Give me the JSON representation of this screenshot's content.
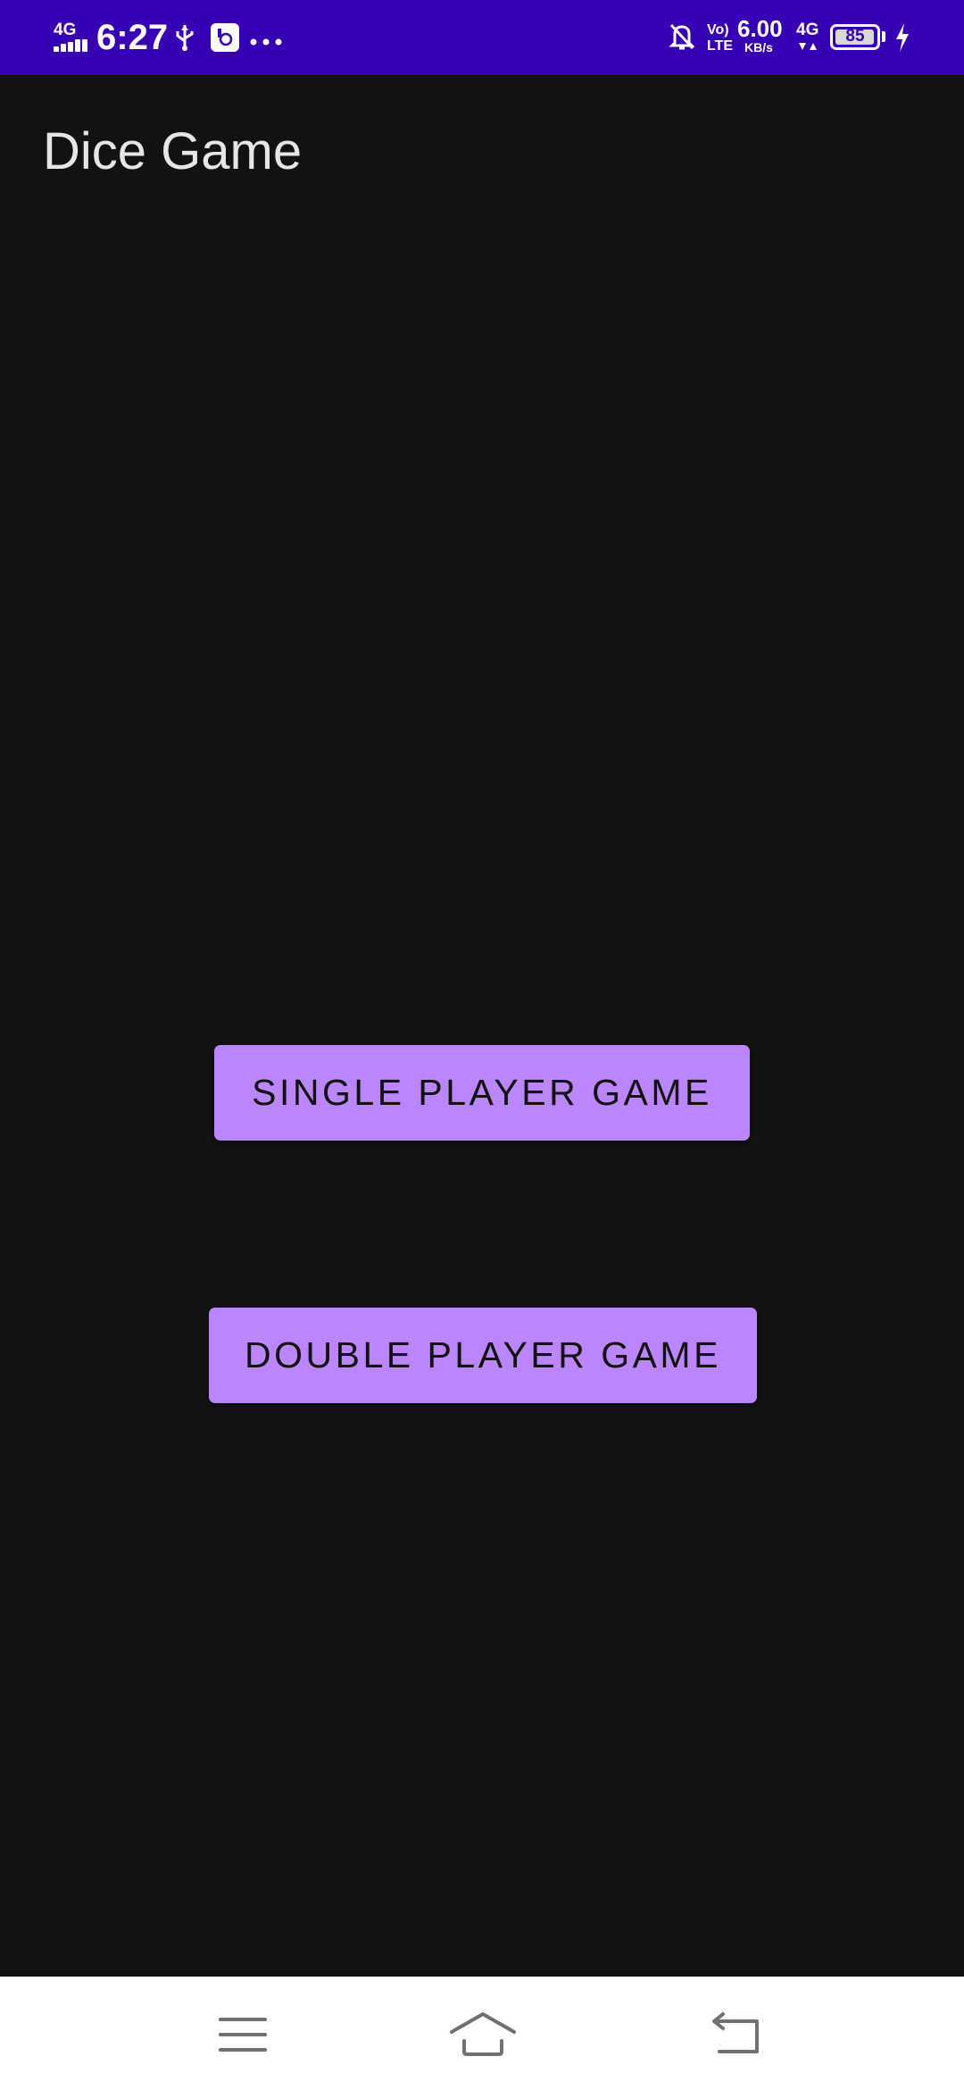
{
  "status_bar": {
    "network_type": "4G",
    "time": "6:27",
    "volte": "Vo)",
    "lte": "LTE",
    "speed_value": "6.00",
    "speed_unit": "KB/s",
    "network_type_2": "4G",
    "battery": "85",
    "icons": [
      "signal-icon",
      "usb-icon",
      "app-notification-icon",
      "more-icon",
      "bell-off-icon",
      "data-arrows-icon",
      "battery-icon",
      "charging-icon"
    ],
    "background_color": "#3700B3"
  },
  "app": {
    "title": "Dice Game",
    "background_color": "#121212"
  },
  "buttons": {
    "single_player": "SINGLE PLAYER GAME",
    "double_player": "DOUBLE PLAYER GAME",
    "color": "#BB86FC"
  },
  "nav_bar": {
    "icons": [
      "menu-icon",
      "home-icon",
      "back-icon"
    ]
  }
}
